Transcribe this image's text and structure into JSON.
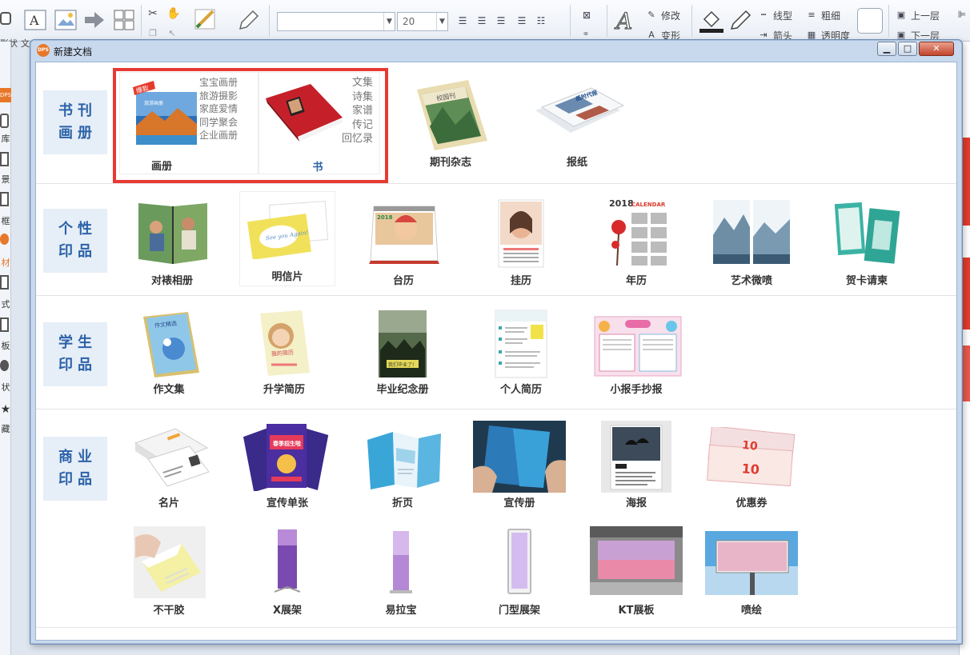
{
  "toolbar": {
    "font_size": "20",
    "left_partial_labels": [
      "形状",
      "文"
    ],
    "modify_label": "修改",
    "transform_label": "变形",
    "line_type_label": "线型",
    "thickness_label": "粗细",
    "arrow_label": "箭头",
    "transparency_label": "透明度",
    "up_layer_label": "上一层",
    "down_layer_label": "下一层"
  },
  "left_panel": {
    "items": [
      "库",
      "景",
      "框",
      "材",
      "式",
      "板",
      "状",
      "藏"
    ],
    "tab": "DPS"
  },
  "dialog": {
    "logo_text": "DPS",
    "title": "新建文档",
    "minimize": "▁",
    "maximize": "□",
    "close": "✕"
  },
  "sections": [
    {
      "label_line1": "书刊",
      "label_line2": "画册",
      "items": [
        {
          "label": "画册",
          "tags": [
            "宝宝画册",
            "旅游摄影",
            "家庭爱情",
            "同学聚会",
            "企业画册"
          ],
          "badge": "爆款",
          "book_text": "旅游画册"
        },
        {
          "label": "书",
          "tags": [
            "文集",
            "诗集",
            "家谱",
            "传记",
            "回忆录"
          ]
        },
        {
          "label": "期刊杂志",
          "cover_text": "校园刊"
        },
        {
          "label": "报纸",
          "cover_text": "纸时代报"
        }
      ]
    },
    {
      "label_line1": "个性",
      "label_line2": "印品",
      "items": [
        {
          "label": "对裱相册"
        },
        {
          "label": "明信片",
          "card_text": "See you Again!"
        },
        {
          "label": "台历",
          "year": "2018"
        },
        {
          "label": "挂历"
        },
        {
          "label": "年历",
          "year": "2018",
          "word": "CALENDAR"
        },
        {
          "label": "艺术微喷"
        },
        {
          "label": "贺卡请柬"
        }
      ]
    },
    {
      "label_line1": "学生",
      "label_line2": "印品",
      "items": [
        {
          "label": "作文集",
          "cover_text": "作文精选"
        },
        {
          "label": "升学简历",
          "cover_text": "我的简历"
        },
        {
          "label": "毕业纪念册",
          "cover_text": "我们毕业了!"
        },
        {
          "label": "个人简历"
        },
        {
          "label": "小报手抄报"
        }
      ]
    },
    {
      "label_line1": "商业",
      "label_line2": "印品",
      "items": [
        {
          "label": "名片"
        },
        {
          "label": "宣传单张",
          "flyer_text": "春季招生啦"
        },
        {
          "label": "折页"
        },
        {
          "label": "宣传册"
        },
        {
          "label": "海报"
        },
        {
          "label": "优惠券",
          "coupon_value": "10"
        },
        {
          "label": "不干胶"
        },
        {
          "label": "X展架"
        },
        {
          "label": "易拉宝"
        },
        {
          "label": "门型展架"
        },
        {
          "label": "KT展板"
        },
        {
          "label": "喷绘"
        }
      ]
    }
  ],
  "colors": {
    "highlight": "#e63a33",
    "section_label_text": "#2b62a8",
    "section_label_bg": "#e6eef7"
  }
}
